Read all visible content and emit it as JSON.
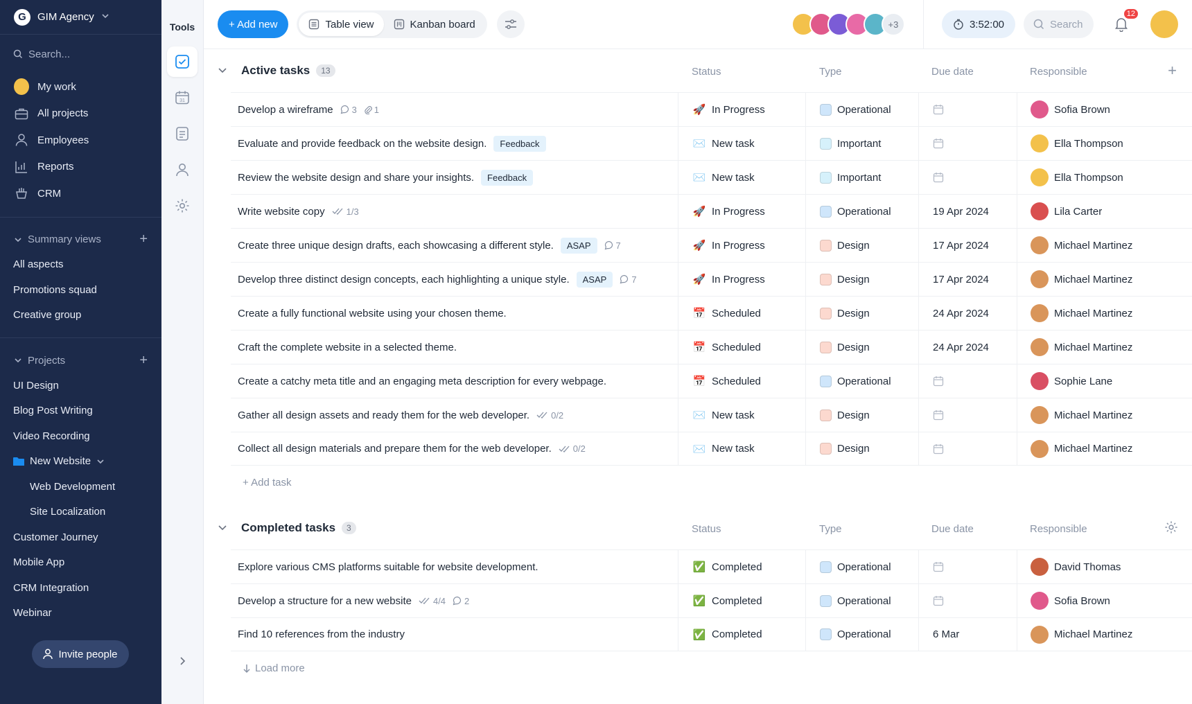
{
  "workspace": {
    "name": "GIM Agency",
    "logo": "G"
  },
  "sidebar": {
    "search_placeholder": "Search...",
    "nav": [
      {
        "label": "My work",
        "icon": "avatar"
      },
      {
        "label": "All projects",
        "icon": "briefcase-icon"
      },
      {
        "label": "Employees",
        "icon": "person-icon"
      },
      {
        "label": "Reports",
        "icon": "chart-icon"
      },
      {
        "label": "CRM",
        "icon": "handshake-icon"
      }
    ],
    "summary_title": "Summary views",
    "summary_views": [
      "All aspects",
      "Promotions squad",
      "Creative group"
    ],
    "projects_title": "Projects",
    "projects": [
      "UI Design",
      "Blog Post Writing",
      "Video Recording"
    ],
    "folder": {
      "label": "New Website",
      "children": [
        "Web Development",
        "Site Localization"
      ]
    },
    "projects_more": [
      "Customer Journey",
      "Mobile App",
      "CRM Integration",
      "Webinar"
    ],
    "invite_label": "Invite people"
  },
  "tools": {
    "title": "Tools"
  },
  "toolbar": {
    "add_label": "+ Add new",
    "table_view": "Table view",
    "kanban": "Kanban board",
    "more_members": "+3",
    "timer": "3:52:00",
    "search_placeholder": "Search",
    "notifications": "12"
  },
  "columns": {
    "status": "Status",
    "type": "Type",
    "due": "Due date",
    "responsible": "Responsible"
  },
  "active": {
    "title": "Active tasks",
    "count": "13",
    "add_task": "+ Add task",
    "tasks": [
      {
        "name": "Develop a wireframe",
        "comments": "3",
        "attach": "1",
        "status": "In Progress",
        "type": "Operational",
        "due": "",
        "resp": "Sofia Brown"
      },
      {
        "name": "Evaluate and provide feedback on the website design.",
        "tag": "Feedback",
        "status": "New task",
        "type": "Important",
        "due": "",
        "resp": "Ella Thompson"
      },
      {
        "name": "Review the website design and share your insights.",
        "tag": "Feedback",
        "status": "New task",
        "type": "Important",
        "due": "",
        "resp": "Ella Thompson"
      },
      {
        "name": "Write website copy",
        "checks": "1/3",
        "status": "In Progress",
        "type": "Operational",
        "due": "19 Apr 2024",
        "resp": "Lila Carter"
      },
      {
        "name": "Create three unique design drafts, each showcasing a different style.",
        "tag": "ASAP",
        "comments": "7",
        "status": "In Progress",
        "type": "Design",
        "due": "17 Apr 2024",
        "resp": "Michael Martinez"
      },
      {
        "name": "Develop three distinct design concepts, each highlighting a unique style.",
        "tag": "ASAP",
        "comments": "7",
        "status": "In Progress",
        "type": "Design",
        "due": "17 Apr 2024",
        "resp": "Michael Martinez"
      },
      {
        "name": "Create a fully functional website using your chosen theme.",
        "status": "Scheduled",
        "type": "Design",
        "due": "24 Apr 2024",
        "resp": "Michael Martinez"
      },
      {
        "name": "Craft the complete website in a selected theme.",
        "status": "Scheduled",
        "type": "Design",
        "due": "24 Apr 2024",
        "resp": "Michael Martinez"
      },
      {
        "name": "Create a catchy meta title and an engaging meta description for every webpage.",
        "status": "Scheduled",
        "type": "Operational",
        "due": "",
        "resp": "Sophie Lane"
      },
      {
        "name": "Gather all design assets and ready them for the web developer.",
        "checks": "0/2",
        "status": "New task",
        "type": "Design",
        "due": "",
        "resp": "Michael Martinez"
      },
      {
        "name": "Collect all design materials and prepare them for the web developer.",
        "checks": "0/2",
        "status": "New task",
        "type": "Design",
        "due": "",
        "resp": "Michael Martinez"
      }
    ]
  },
  "completed": {
    "title": "Completed tasks",
    "count": "3",
    "load_more": "Load more",
    "tasks": [
      {
        "name": "Explore various CMS platforms suitable for website development.",
        "status": "Completed",
        "type": "Operational",
        "due": "",
        "resp": "David Thomas"
      },
      {
        "name": "Develop a structure for a new website",
        "checks": "4/4",
        "comments": "2",
        "status": "Completed",
        "type": "Operational",
        "due": "",
        "resp": "Sofia Brown"
      },
      {
        "name": "Find 10 references from the industry",
        "status": "Completed",
        "type": "Operational",
        "due": "6 Mar",
        "resp": "Michael Martinez"
      }
    ]
  },
  "colors": {
    "accent": "#1a8cf0",
    "sidebar_bg": "#1c2a4a",
    "type_operational": "#cfe6fb",
    "type_important": "#d6f1fb",
    "type_design": "#fcd9cf"
  }
}
